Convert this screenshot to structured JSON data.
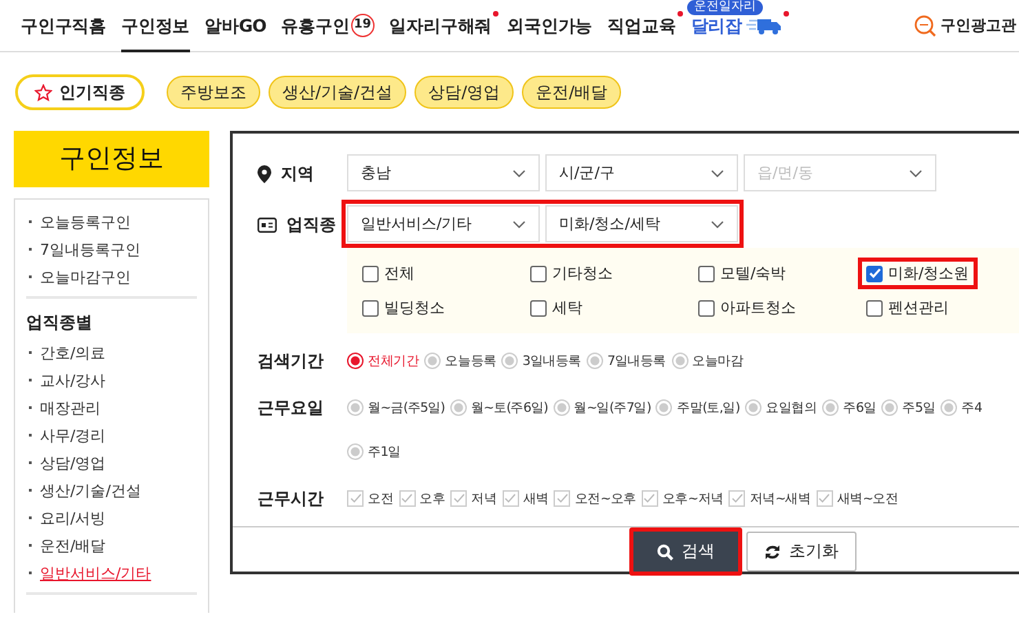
{
  "nav": {
    "tabs": [
      {
        "label": "구인구직홈",
        "selected": false
      },
      {
        "label": "구인정보",
        "selected": true
      },
      {
        "label": "알바GO",
        "selected": false
      },
      {
        "label": "유흥구인",
        "selected": false,
        "badge": "19"
      },
      {
        "label": "일자리구해줘",
        "selected": false,
        "dot": true
      },
      {
        "label": "외국인가능",
        "selected": false
      },
      {
        "label": "직업교육",
        "selected": false,
        "dot": true
      },
      {
        "label": "달리잡",
        "selected": false,
        "dot": true,
        "tag": "운전일자리",
        "kind": "promo"
      }
    ],
    "ad_link": "구인광고관"
  },
  "chips": {
    "popular": "인기직종",
    "items": [
      "주방보조",
      "생산/기술/건설",
      "상담/영업",
      "운전/배달"
    ]
  },
  "sidebar": {
    "title": "구인정보",
    "quick_links": [
      {
        "label": "오늘등록구인",
        "selected": false
      },
      {
        "label": "7일내등록구인",
        "selected": false
      },
      {
        "label": "오늘마감구인",
        "selected": false
      }
    ],
    "section": "업직종별",
    "items": [
      {
        "label": "간호/의료",
        "selected": false
      },
      {
        "label": "교사/강사",
        "selected": false
      },
      {
        "label": "매장관리",
        "selected": false
      },
      {
        "label": "사무/경리",
        "selected": false
      },
      {
        "label": "상담/영업",
        "selected": false
      },
      {
        "label": "생산/기술/건설",
        "selected": false
      },
      {
        "label": "요리/서빙",
        "selected": false
      },
      {
        "label": "운전/배달",
        "selected": false
      },
      {
        "label": "일반서비스/기타",
        "selected": true
      }
    ]
  },
  "search": {
    "region": {
      "label": "지역",
      "selects": [
        {
          "value": "충남"
        },
        {
          "value": "시/군/구"
        },
        {
          "placeholder": "읍/면/동"
        }
      ]
    },
    "job": {
      "label": "업직종",
      "highlighted": true,
      "selects": [
        {
          "value": "일반서비스/기타"
        },
        {
          "value": "미화/청소/세탁"
        }
      ],
      "options": [
        {
          "label": "전체",
          "checked": false,
          "highlighted": false
        },
        {
          "label": "기타청소",
          "checked": false,
          "highlighted": false
        },
        {
          "label": "모텔/숙박",
          "checked": false,
          "highlighted": false
        },
        {
          "label": "미화/청소원",
          "checked": true,
          "highlighted": true
        },
        {
          "label": "빌딩청소",
          "checked": false,
          "highlighted": false
        },
        {
          "label": "세탁",
          "checked": false,
          "highlighted": false
        },
        {
          "label": "아파트청소",
          "checked": false,
          "highlighted": false
        },
        {
          "label": "펜션관리",
          "checked": false,
          "highlighted": false
        }
      ]
    },
    "period": {
      "label": "검색기간",
      "options": [
        {
          "label": "전체기간",
          "selected": true
        },
        {
          "label": "오늘등록",
          "selected": false
        },
        {
          "label": "3일내등록",
          "selected": false
        },
        {
          "label": "7일내등록",
          "selected": false
        },
        {
          "label": "오늘마감",
          "selected": false
        }
      ]
    },
    "days": {
      "label": "근무요일",
      "options": [
        {
          "label": "월~금(주5일)",
          "selected": false
        },
        {
          "label": "월~토(주6일)",
          "selected": false
        },
        {
          "label": "월~일(주7일)",
          "selected": false
        },
        {
          "label": "주말(토,일)",
          "selected": false
        },
        {
          "label": "요일협의",
          "selected": false
        },
        {
          "label": "주6일",
          "selected": false
        },
        {
          "label": "주5일",
          "selected": false
        },
        {
          "label": "주4",
          "selected": false
        },
        {
          "label": "주1일",
          "selected": false
        }
      ]
    },
    "hours": {
      "label": "근무시간",
      "options": [
        {
          "label": "오전",
          "checked": false
        },
        {
          "label": "오후",
          "checked": false
        },
        {
          "label": "저녁",
          "checked": false
        },
        {
          "label": "새벽",
          "checked": false
        },
        {
          "label": "오전~오후",
          "checked": false
        },
        {
          "label": "오후~저녁",
          "checked": false
        },
        {
          "label": "저녁~새벽",
          "checked": false
        },
        {
          "label": "새벽~오전",
          "checked": false
        }
      ]
    },
    "buttons": [
      {
        "label": "검색",
        "kind": "search",
        "highlighted": true
      },
      {
        "label": "초기화",
        "kind": "reset",
        "highlighted": false
      }
    ]
  }
}
